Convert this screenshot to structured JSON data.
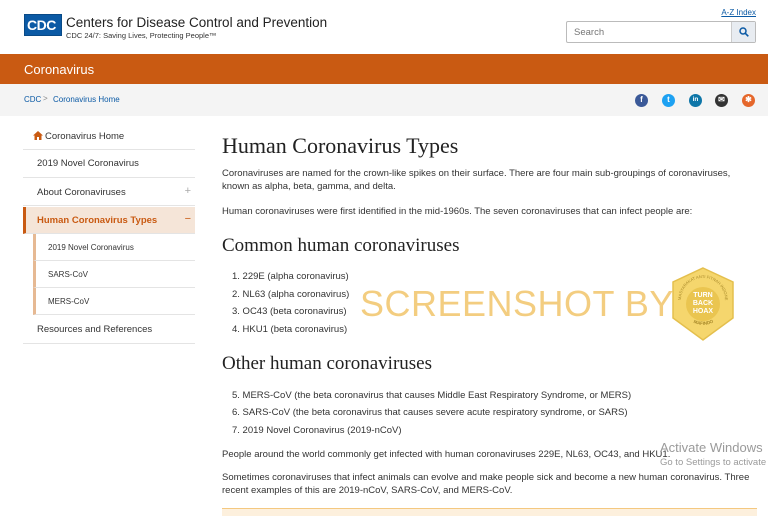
{
  "header": {
    "logo": "CDC",
    "title": "Centers for Disease Control and Prevention",
    "tagline": "CDC 24/7: Saving Lives, Protecting People™",
    "az_index": "A-Z Index",
    "search_placeholder": "Search"
  },
  "topic": {
    "title": "Coronavirus"
  },
  "breadcrumb": [
    "CDC",
    "Coronavirus Home"
  ],
  "breadcrumb_sep": ">",
  "share_icons": [
    {
      "name": "facebook-icon",
      "glyph": "f",
      "color": "#3b5998"
    },
    {
      "name": "twitter-icon",
      "glyph": "t",
      "color": "#1da1f2"
    },
    {
      "name": "linkedin-icon",
      "glyph": "in",
      "color": "#0e76a8"
    },
    {
      "name": "email-icon",
      "glyph": "✉",
      "color": "#333333"
    },
    {
      "name": "syndicate-icon",
      "glyph": "✱",
      "color": "#e5672b"
    }
  ],
  "sidebar": {
    "items": [
      {
        "label": "Coronavirus Home"
      },
      {
        "label": "2019 Novel Coronavirus"
      },
      {
        "label": "About Coronaviruses",
        "expander": "+"
      },
      {
        "label": "Human Coronavirus Types",
        "expander": "−"
      },
      {
        "label": "2019 Novel Coronavirus"
      },
      {
        "label": "SARS-CoV"
      },
      {
        "label": "MERS-CoV"
      },
      {
        "label": "Resources and References"
      }
    ]
  },
  "main": {
    "title": "Human Coronavirus Types",
    "intro": "Coronaviruses are named for the crown-like spikes on their surface. There are four main sub-groupings of coronaviruses, known as alpha, beta, gamma, and delta.",
    "first_identified": "Human coronaviruses were first identified in the mid-1960s. The seven coronaviruses that can infect people are:",
    "common_heading": "Common human coronaviruses",
    "common_list": [
      "1. 229E (alpha coronavirus)",
      "2. NL63 (alpha coronavirus)",
      "3. OC43 (beta coronavirus)",
      "4. HKU1 (beta coronavirus)"
    ],
    "other_heading": "Other human coronaviruses",
    "other_list": [
      "5. MERS-CoV (the beta coronavirus that causes Middle East Respiratory Syndrome, or MERS)",
      "6. SARS-CoV (the beta coronavirus that causes severe acute respiratory syndrome, or SARS)",
      "7. 2019 Novel Coronavirus (2019-nCoV)"
    ],
    "common_infect": "People around the world commonly get infected with human coronaviruses 229E, NL63, OC43, and HKU1.",
    "animals": "Sometimes coronaviruses that infect animals can evolve and make people sick and become a new human coronavirus. Three recent examples of this are 2019-nCoV, SARS-CoV, and MERS-CoV."
  },
  "watermark": {
    "text": "SCREENSHOT BY",
    "badge_lines": [
      "TURN",
      "BACK",
      "HOAX"
    ],
    "badge_ring_top": "MASYARAKAT ANTI FITNAH INDONESIA",
    "badge_ring_bottom": "MAFINDO"
  },
  "windows_activation": {
    "title": "Activate Windows",
    "subtitle": "Go to Settings to activate"
  },
  "colors": {
    "brand_blue": "#0b5aa5",
    "topic_orange": "#c95a12",
    "active_bg": "#f5e5d8"
  }
}
